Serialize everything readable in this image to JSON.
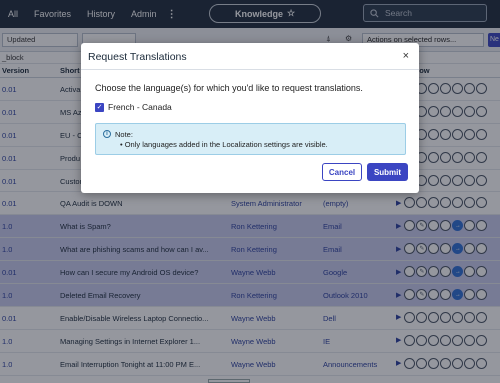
{
  "nav": {
    "items": [
      "All",
      "Favorites",
      "History",
      "Admin"
    ],
    "more": "⋮",
    "pill_label": "Knowledge",
    "pill_star": "☆",
    "search_placeholder": "Search"
  },
  "toolbar": {
    "filter_value": "Updated",
    "search_placeholder": "Search",
    "actions_label": "Actions on selected rows...",
    "new_label": "Ne"
  },
  "breadcrumb": "_block",
  "columns": {
    "version": "Version",
    "short": "Short d",
    "workflow": "Workflow"
  },
  "rows": [
    {
      "version": "0.01",
      "short": "Activa",
      "author": "",
      "category": "",
      "highlight": false
    },
    {
      "version": "0.01",
      "short": "MS Az",
      "author": "",
      "category": "",
      "highlight": false
    },
    {
      "version": "0.01",
      "short": "EU - C",
      "author": "",
      "category": "",
      "highlight": false
    },
    {
      "version": "0.01",
      "short": "Produ",
      "author": "",
      "category": "",
      "highlight": false
    },
    {
      "version": "0.01",
      "short": "Custon",
      "author": "",
      "category": "",
      "highlight": false
    },
    {
      "version": "0.01",
      "short": "QA Audit is DOWN",
      "author": "System Administrator",
      "category": "(empty)",
      "highlight": false
    },
    {
      "version": "1.0",
      "short": "What is Spam?",
      "author": "Ron Kettering",
      "category": "Email",
      "highlight": true
    },
    {
      "version": "1.0",
      "short": "What are phishing scams and how can I av...",
      "author": "Ron Kettering",
      "category": "Email",
      "highlight": true
    },
    {
      "version": "0.01",
      "short": "How can I secure my Android OS device?",
      "author": "Wayne Webb",
      "category": "Google",
      "highlight": true
    },
    {
      "version": "1.0",
      "short": "Deleted Email Recovery",
      "author": "Ron Kettering",
      "category": "Outlook 2010",
      "highlight": true
    },
    {
      "version": "0.01",
      "short": "Enable/Disable Wireless Laptop Connectio...",
      "author": "Wayne Webb",
      "category": "Dell",
      "highlight": false
    },
    {
      "version": "1.0",
      "short": "Managing Settings in Internet Explorer 1...",
      "author": "Wayne Webb",
      "category": "IE",
      "highlight": false
    },
    {
      "version": "1.0",
      "short": "Email Interruption Tonight at 11:00 PM E...",
      "author": "Wayne Webb",
      "category": "Announcements",
      "highlight": false
    }
  ],
  "modal": {
    "title": "Request Translations",
    "close": "×",
    "prompt": "Choose the language(s) for which you'd like to request translations.",
    "language": "French - Canada",
    "language_checked": true,
    "note_icon": "i",
    "note_title": "Note:",
    "note_bullet": "• Only languages added in the Localization settings are visible.",
    "cancel_label": "Cancel",
    "submit_label": "Submit"
  },
  "colors": {
    "accent": "#3b45c2",
    "nav_bg": "#1f2d3d",
    "note_bg": "#d8eef7"
  }
}
